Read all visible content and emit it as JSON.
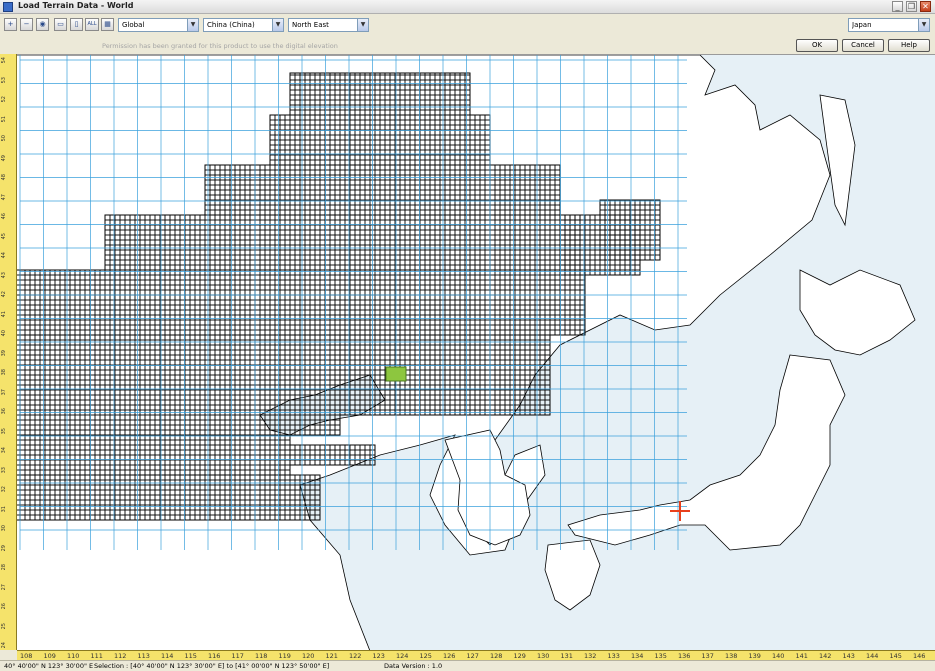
{
  "window": {
    "title": "Load Terrain Data - World",
    "controls": [
      "_",
      "❐",
      "✕"
    ]
  },
  "toolbar": {
    "tools": [
      {
        "name": "zoom-in",
        "glyph": "+"
      },
      {
        "name": "zoom-out",
        "glyph": "−"
      },
      {
        "name": "zoom-fit",
        "glyph": "◉"
      },
      {
        "name": "select-rect",
        "glyph": "▭"
      },
      {
        "name": "select-single",
        "glyph": "▯"
      },
      {
        "name": "select-all",
        "glyph": "ALL"
      },
      {
        "name": "grid",
        "glyph": "▦"
      }
    ],
    "region_select": "Global",
    "country_select": "China (China)",
    "area_select": "North East",
    "right_select": "Japan"
  },
  "permission_text": "Permission has been granted for this product to use the digital elevation",
  "buttons": {
    "ok": "OK",
    "cancel": "Cancel",
    "help": "Help"
  },
  "map": {
    "land_color": "#ffffff",
    "sea_color": "#e6f0f6",
    "grid_color": "#3aa0dc",
    "tile_color": "#000000",
    "selection_color": "#8dc63f",
    "marker_color": "#e8401c"
  },
  "ruler": {
    "longitudes": [
      "108",
      "109",
      "110",
      "111",
      "112",
      "113",
      "114",
      "115",
      "116",
      "117",
      "118",
      "119",
      "120",
      "121",
      "122",
      "123",
      "124",
      "125",
      "126",
      "127",
      "128",
      "129",
      "130",
      "131",
      "132",
      "133",
      "134",
      "135",
      "136",
      "137",
      "138",
      "139",
      "140",
      "141",
      "142",
      "143",
      "144",
      "145",
      "146"
    ],
    "latitudes": [
      "54",
      "53",
      "52",
      "51",
      "50",
      "49",
      "48",
      "47",
      "46",
      "45",
      "44",
      "43",
      "42",
      "41",
      "40",
      "39",
      "38",
      "37",
      "36",
      "35",
      "34",
      "33",
      "32",
      "31",
      "30",
      "29",
      "28",
      "27",
      "26",
      "25",
      "24"
    ]
  },
  "status": {
    "coordinates": "40° 40'00\" N 123° 30'00\" E",
    "selection": "Selection : [40° 40'00\" N 123° 30'00\" E] to [41° 00'00\" N 123° 50'00\" E]",
    "data_version": "Data Version : 1.0"
  }
}
